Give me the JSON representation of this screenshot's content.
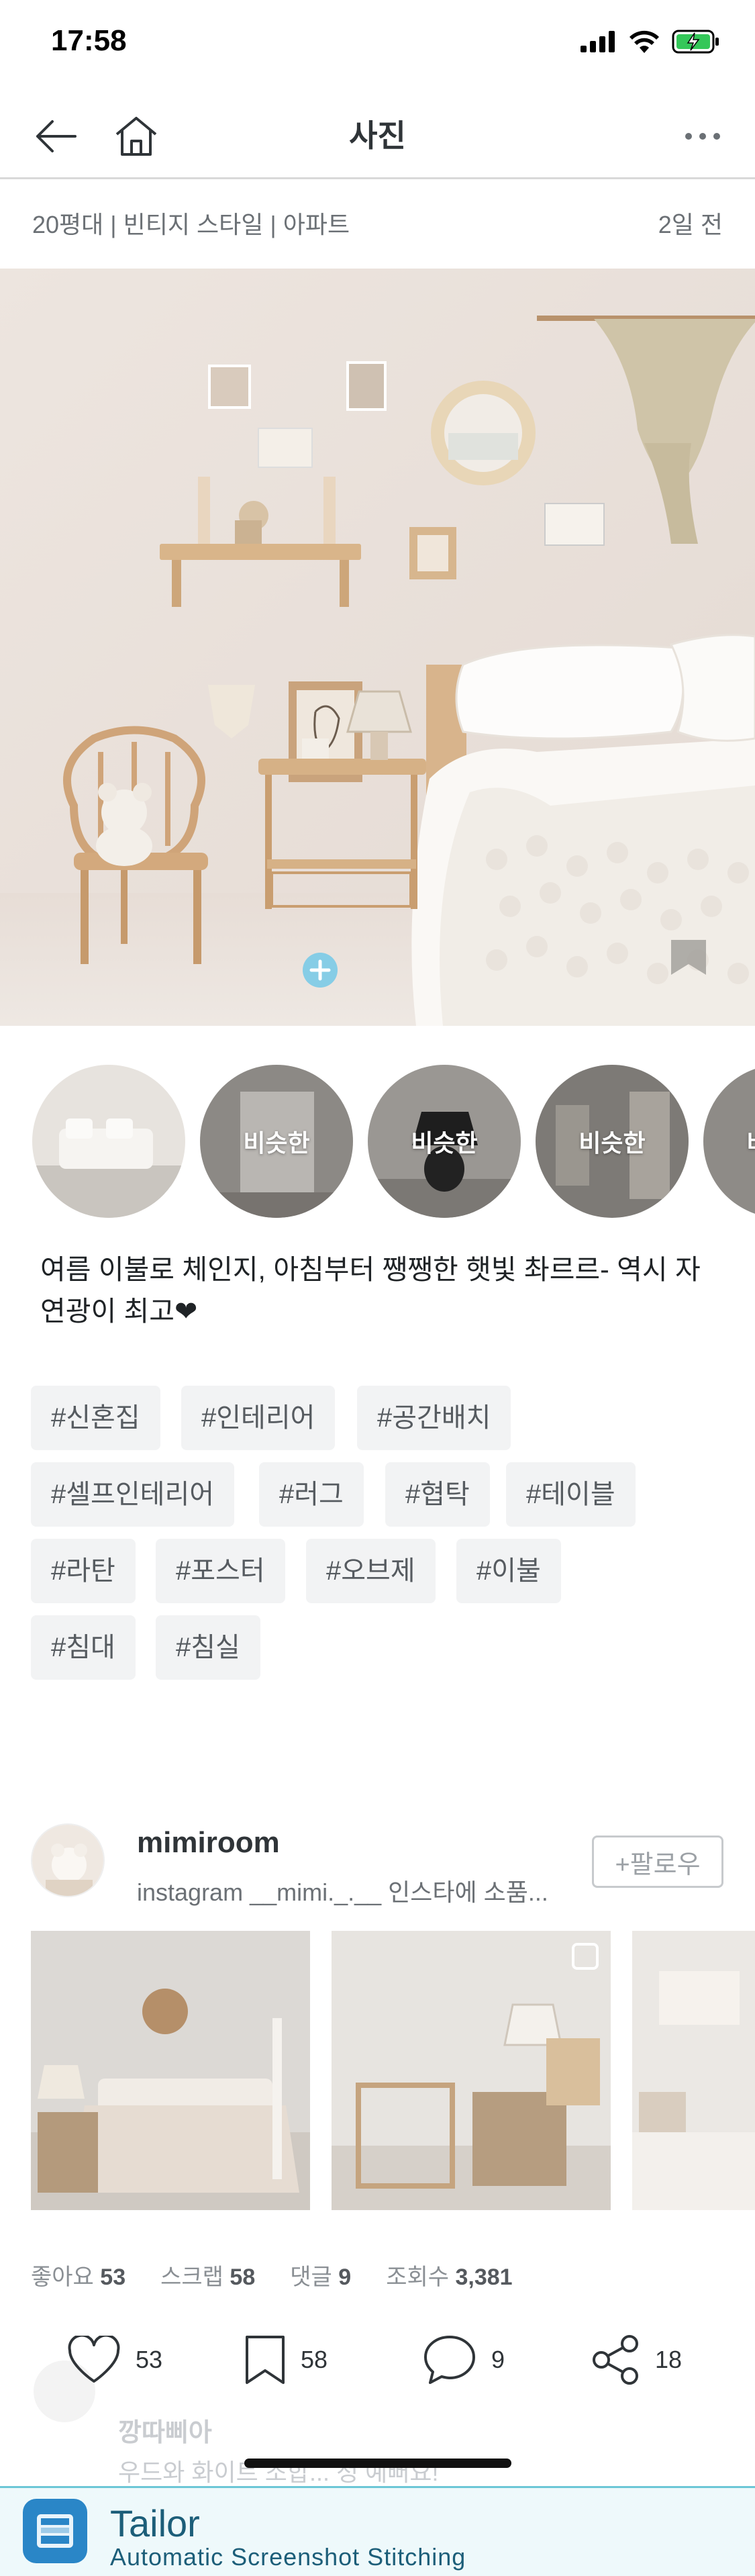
{
  "status_bar": {
    "time": "17:58"
  },
  "nav": {
    "title": "사진"
  },
  "post": {
    "meta_left": "20평대 | 빈티지 스타일 | 아파트",
    "meta_right": "2일 전",
    "caption": "여름 이불로 체인지, 아침부터 쨍쨍한 햇빛 촤르르- 역시 자연광이 최고❤",
    "similar_label": "비슷한",
    "tags": [
      "#신혼집",
      "#인테리어",
      "#공간배치",
      "#셀프인테리어",
      "#러그",
      "#협탁",
      "#테이블",
      "#라탄",
      "#포스터",
      "#오브제",
      "#이불",
      "#침대",
      "#침실"
    ]
  },
  "user": {
    "name": "mimiroom",
    "subtitle": "instagram  __mimi._.__ 인스타에 소품...",
    "follow_label": "+팔로우"
  },
  "stats": {
    "likes_label": "좋아요",
    "likes": "53",
    "scraps_label": "스크랩",
    "scraps": "58",
    "comments_label": "댓글",
    "comments": "9",
    "views_label": "조회수",
    "views": "3,381"
  },
  "actions": {
    "like": "53",
    "scrap": "58",
    "comment": "9",
    "share": "18"
  },
  "comment_preview": {
    "author": "깡따삐아",
    "text": "우드와 화이트 조합... 정 예뻐요!"
  },
  "banner": {
    "title": "Tailor",
    "subtitle": "Automatic Screenshot Stitching"
  },
  "colors": {
    "accent": "#35c5f0",
    "text": "#2f3438",
    "tag_bg": "#f2f3f4",
    "banner_bg": "#eef9fb"
  }
}
